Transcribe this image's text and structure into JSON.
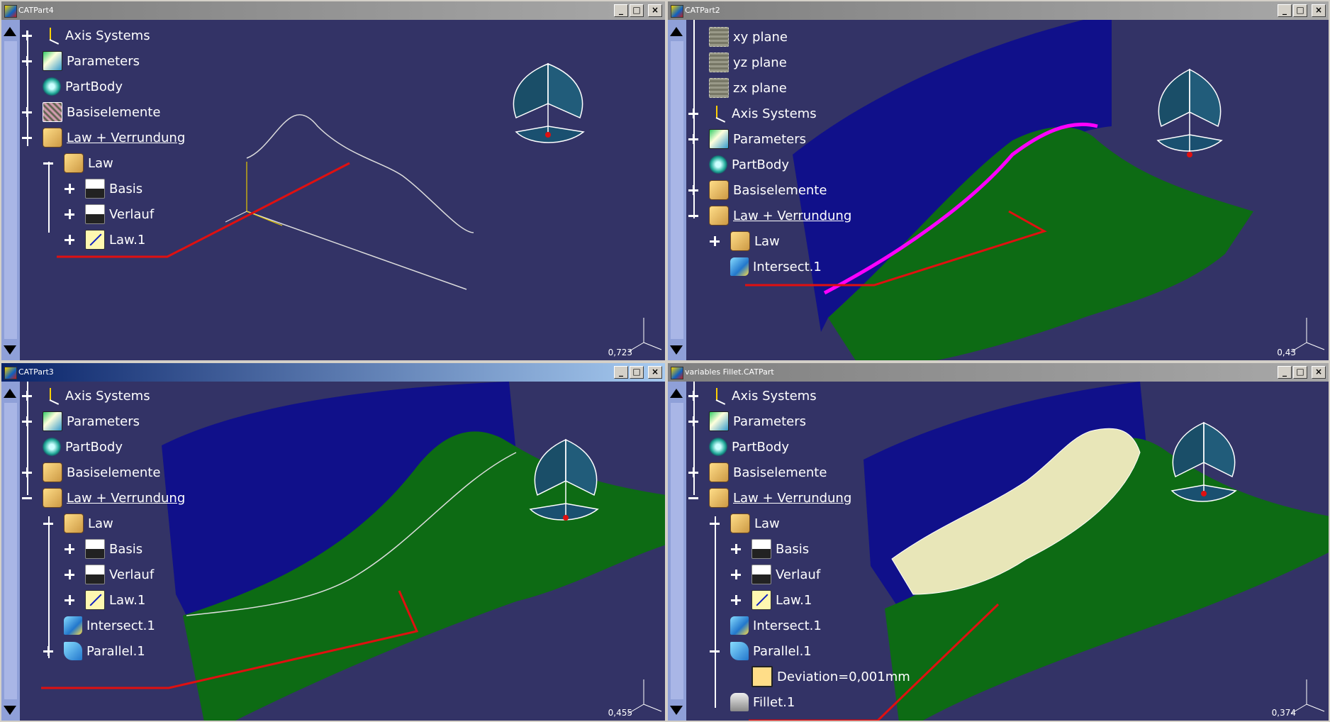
{
  "windows": [
    {
      "title": "CATPart4",
      "active": false,
      "scale": "0,723",
      "tree": [
        {
          "label": "Axis Systems",
          "icon": "axis",
          "exp": "plus",
          "level": 0,
          "underline": false
        },
        {
          "label": "Parameters",
          "icon": "param",
          "exp": "plus",
          "level": 0,
          "underline": false
        },
        {
          "label": "PartBody",
          "icon": "body",
          "exp": "none",
          "level": 0,
          "underline": false
        },
        {
          "label": "Basiselemente",
          "icon": "base",
          "exp": "plus",
          "level": 0,
          "underline": false
        },
        {
          "label": "Law + Verrundung",
          "icon": "law",
          "exp": "minus",
          "level": 0,
          "underline": true
        },
        {
          "label": "Law",
          "icon": "law",
          "exp": "minus",
          "level": 1,
          "underline": false
        },
        {
          "label": "Basis",
          "icon": "sketch",
          "exp": "plus",
          "level": 2,
          "underline": false
        },
        {
          "label": "Verlauf",
          "icon": "sketch",
          "exp": "plus",
          "level": 2,
          "underline": false
        },
        {
          "label": "Law.1",
          "icon": "lawcurve",
          "exp": "plus",
          "level": 2,
          "underline": false
        }
      ]
    },
    {
      "title": "CATPart2",
      "active": false,
      "scale": "0,43",
      "tree": [
        {
          "label": "xy plane",
          "icon": "plane",
          "exp": "none",
          "level": 0,
          "underline": false
        },
        {
          "label": "yz plane",
          "icon": "plane",
          "exp": "none",
          "level": 0,
          "underline": false
        },
        {
          "label": "zx plane",
          "icon": "plane",
          "exp": "none",
          "level": 0,
          "underline": false
        },
        {
          "label": "Axis Systems",
          "icon": "axis",
          "exp": "plus",
          "level": 0,
          "underline": false
        },
        {
          "label": "Parameters",
          "icon": "param",
          "exp": "plus",
          "level": 0,
          "underline": false
        },
        {
          "label": "PartBody",
          "icon": "body",
          "exp": "none",
          "level": 0,
          "underline": false
        },
        {
          "label": "Basiselemente",
          "icon": "law",
          "exp": "plus",
          "level": 0,
          "underline": false
        },
        {
          "label": "Law + Verrundung",
          "icon": "law",
          "exp": "minus",
          "level": 0,
          "underline": true
        },
        {
          "label": "Law",
          "icon": "law",
          "exp": "plus",
          "level": 1,
          "underline": false
        },
        {
          "label": "Intersect.1",
          "icon": "intersect",
          "exp": "none",
          "level": 1,
          "underline": false
        }
      ]
    },
    {
      "title": "CATPart3",
      "active": true,
      "scale": "0,455",
      "tree": [
        {
          "label": "Axis Systems",
          "icon": "axis",
          "exp": "plus",
          "level": 0,
          "underline": false
        },
        {
          "label": "Parameters",
          "icon": "param",
          "exp": "plus",
          "level": 0,
          "underline": false
        },
        {
          "label": "PartBody",
          "icon": "body",
          "exp": "none",
          "level": 0,
          "underline": false
        },
        {
          "label": "Basiselemente",
          "icon": "law",
          "exp": "plus",
          "level": 0,
          "underline": false
        },
        {
          "label": "Law + Verrundung",
          "icon": "law",
          "exp": "minus",
          "level": 0,
          "underline": true
        },
        {
          "label": "Law",
          "icon": "law",
          "exp": "minus",
          "level": 1,
          "underline": false
        },
        {
          "label": "Basis",
          "icon": "sketch",
          "exp": "plus",
          "level": 2,
          "underline": false
        },
        {
          "label": "Verlauf",
          "icon": "sketch",
          "exp": "plus",
          "level": 2,
          "underline": false
        },
        {
          "label": "Law.1",
          "icon": "lawcurve",
          "exp": "plus",
          "level": 2,
          "underline": false
        },
        {
          "label": "Intersect.1",
          "icon": "intersect",
          "exp": "none",
          "level": 1,
          "underline": false
        },
        {
          "label": "Parallel.1",
          "icon": "parallel",
          "exp": "plus",
          "level": 1,
          "underline": false
        }
      ]
    },
    {
      "title": "variables Fillet.CATPart",
      "active": false,
      "scale": "0,374",
      "tree": [
        {
          "label": "Axis Systems",
          "icon": "axis",
          "exp": "plus",
          "level": 0,
          "underline": false
        },
        {
          "label": "Parameters",
          "icon": "param",
          "exp": "plus",
          "level": 0,
          "underline": false
        },
        {
          "label": "PartBody",
          "icon": "body",
          "exp": "none",
          "level": 0,
          "underline": false
        },
        {
          "label": "Basiselemente",
          "icon": "law",
          "exp": "plus",
          "level": 0,
          "underline": false
        },
        {
          "label": "Law + Verrundung",
          "icon": "law",
          "exp": "minus",
          "level": 0,
          "underline": true
        },
        {
          "label": "Law",
          "icon": "law",
          "exp": "minus",
          "level": 1,
          "underline": false
        },
        {
          "label": "Basis",
          "icon": "sketch",
          "exp": "plus",
          "level": 2,
          "underline": false
        },
        {
          "label": "Verlauf",
          "icon": "sketch",
          "exp": "plus",
          "level": 2,
          "underline": false
        },
        {
          "label": "Law.1",
          "icon": "lawcurve",
          "exp": "plus",
          "level": 2,
          "underline": false
        },
        {
          "label": "Intersect.1",
          "icon": "intersect",
          "exp": "none",
          "level": 1,
          "underline": false
        },
        {
          "label": "Parallel.1",
          "icon": "parallel",
          "exp": "minus",
          "level": 1,
          "underline": false
        },
        {
          "label": "Deviation=0,001mm",
          "icon": "dev",
          "exp": "none",
          "level": 2,
          "underline": false
        },
        {
          "label": "Fillet.1",
          "icon": "fillet",
          "exp": "none",
          "level": 1,
          "underline": false
        }
      ]
    }
  ],
  "window_buttons": {
    "minimize": "_",
    "maximize": "□",
    "close": "×"
  },
  "colors": {
    "viewport_bg": "#333366",
    "surface_green": "#0d6b14",
    "surface_blue": "#10108a",
    "highlight_magenta": "#ff00ff",
    "annotation_red": "#e01010",
    "fillet_cream": "#e8e6b8"
  }
}
